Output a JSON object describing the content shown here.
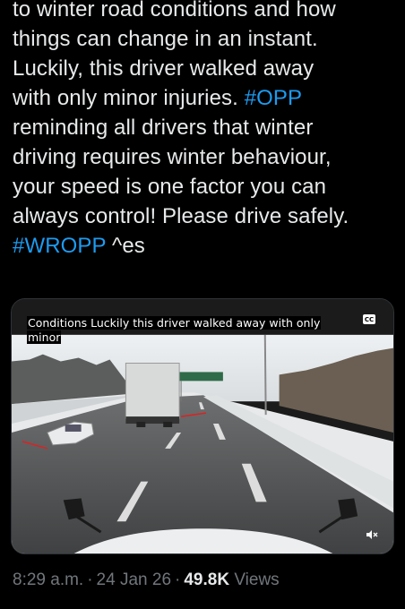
{
  "tweet": {
    "lines": [
      {
        "text": "to winter road conditions and how"
      },
      {
        "text": "things can change in an instant."
      },
      {
        "text": "Luckily, this driver walked away"
      },
      {
        "text": "with only minor injuries. ",
        "hashtag": "#OPP"
      },
      {
        "text": "reminding all drivers that winter"
      },
      {
        "text": "driving requires winter behaviour,"
      },
      {
        "text": "your speed is one factor you can"
      },
      {
        "text": "always control!  Please drive safely."
      },
      {
        "hashtag": "#WROPP",
        "text": " ^es"
      }
    ]
  },
  "video": {
    "caption_line1": "Conditions Luckily this driver walked away with only",
    "caption_line2": "minor",
    "cc_label": "CC",
    "mute_icon": "volume-muted-icon"
  },
  "meta": {
    "time": "8:29 a.m.",
    "date": "24 Jan 26",
    "views_count": "49.8K",
    "views_label": "Views",
    "separator": "·"
  },
  "colors": {
    "background": "#000000",
    "text": "#e7e9ea",
    "hashtag": "#1d9bf0",
    "muted": "#71767b"
  }
}
